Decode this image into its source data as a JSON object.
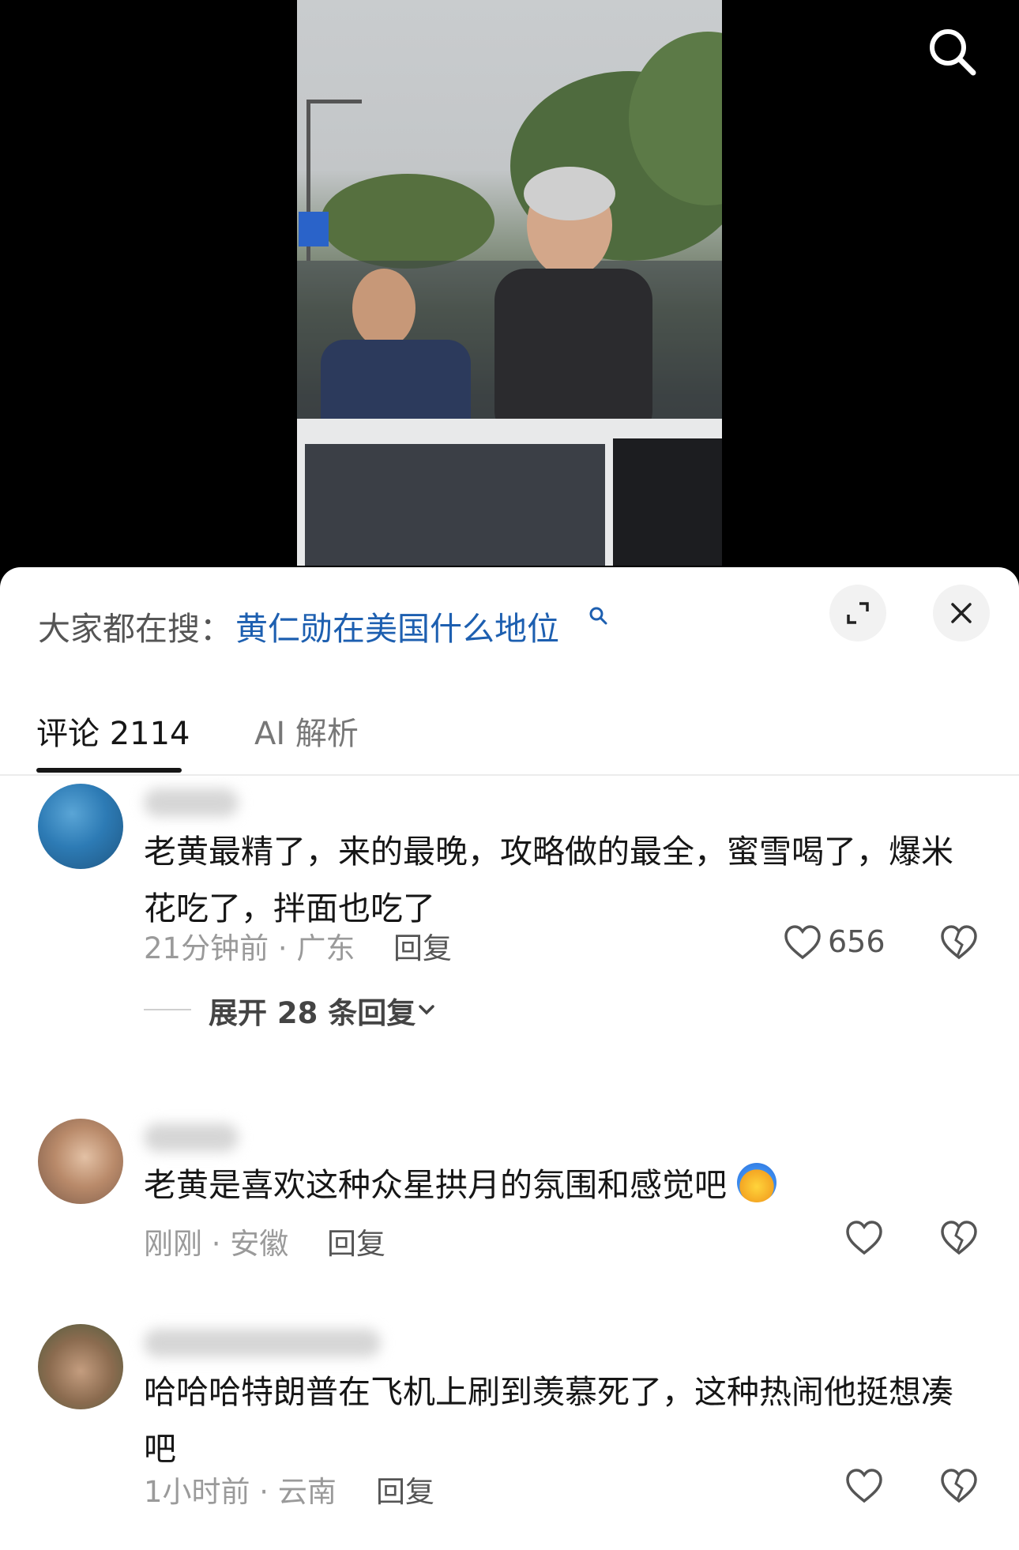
{
  "header": {
    "trending_label": "大家都在搜：",
    "trending_query": "黄仁勋在美国什么地位"
  },
  "tabs": [
    {
      "label": "评论 2114"
    },
    {
      "label": "AI 解析"
    }
  ],
  "comments": [
    {
      "text": "老黄最精了，来的最晚，攻略做的最全，蜜雪喝了，爆米花吃了，拌面也吃了",
      "meta": "21分钟前 · 广东",
      "reply_label": "回复",
      "likes": "656",
      "expand_replies_label": "展开 28 条回复"
    },
    {
      "text": "老黄是喜欢这种众星拱月的氛围和感觉吧",
      "meta": "刚刚 · 安徽",
      "reply_label": "回复",
      "likes": ""
    },
    {
      "text": "哈哈哈特朗普在飞机上刷到羡慕死了，这种热闹他挺想凑吧",
      "meta": "1小时前 · 云南",
      "reply_label": "回复",
      "likes": ""
    }
  ],
  "icons": {
    "search": "search-icon",
    "expand": "expand-icon",
    "close": "close-icon",
    "like": "heart-icon",
    "dislike": "broken-heart-icon",
    "chevron": "chevron-down-icon"
  },
  "colors": {
    "link_blue": "#1d5fb0",
    "text": "#161616",
    "muted": "#9a9a9a"
  }
}
